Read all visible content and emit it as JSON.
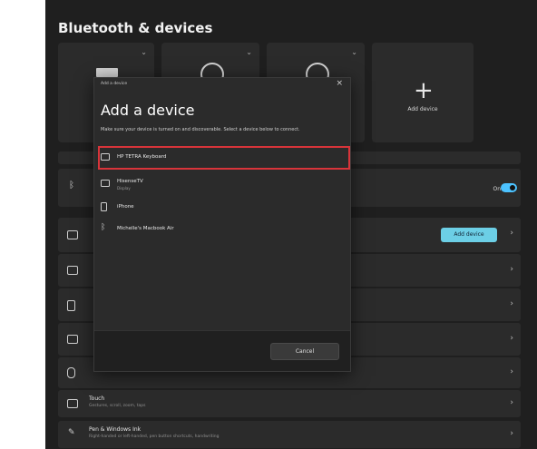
{
  "page": {
    "title": "Bluetooth & devices"
  },
  "tiles": [
    {
      "label": ""
    },
    {
      "label": ""
    },
    {
      "label": ""
    },
    {
      "label": "Add device"
    }
  ],
  "settings": {
    "bluetooth": {
      "title": "",
      "toggle_label": "On"
    },
    "devices": {
      "title": "",
      "button": "Add device"
    },
    "printers": {
      "title": ""
    },
    "phone": {
      "title": ""
    },
    "cameras": {
      "title": ""
    },
    "mouse": {
      "title": "",
      "subtitle": ""
    },
    "touchpad": {
      "title": "Touch",
      "subtitle": "Gestures, scroll, zoom, taps"
    },
    "pen": {
      "title": "Pen & Windows Ink",
      "subtitle": "Right-handed or left-handed, pen button shortcuts, handwriting"
    }
  },
  "dialog": {
    "window_title": "Add a device",
    "heading": "Add a device",
    "description": "Make sure your device is turned on and discoverable. Select a device below to connect.",
    "devices": [
      {
        "name": "HP TETRA Keyboard",
        "sub": ""
      },
      {
        "name": "HisenseTV",
        "sub": "Display"
      },
      {
        "name": "iPhone",
        "sub": ""
      },
      {
        "name": "Michelle's Macbook Air",
        "sub": ""
      }
    ],
    "cancel": "Cancel"
  }
}
